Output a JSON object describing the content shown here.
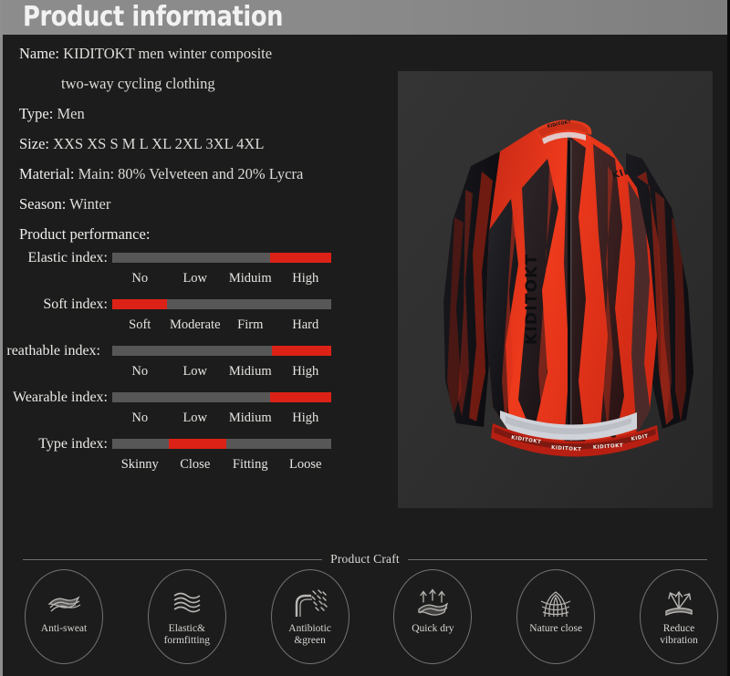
{
  "header": {
    "title": "Product information"
  },
  "colors": {
    "page_bg": "#1c1c1c",
    "header_gray": "#8c8c8c",
    "bar_track": "#575757",
    "bar_fill_red": "#dc2216",
    "text": "#e8e6e2",
    "panel_bg": "#2e2e2e",
    "badge_outline": "#737373",
    "jersey_red": "#e8361c",
    "jersey_black": "#16161a"
  },
  "info": {
    "lines": [
      {
        "key": "Name:",
        "value": "KIDITOKT men winter composite"
      },
      {
        "key": "",
        "value": "two-way cycling clothing",
        "indented": true
      },
      {
        "key": "Type:",
        "value": "Men"
      },
      {
        "key": "Size:",
        "value": "XXS XS S M L XL 2XL 3XL 4XL"
      },
      {
        "key": "Material:",
        "value": "Main: 80% Velveteen and 20% Lycra"
      },
      {
        "key": "Season:",
        "value": "Winter"
      },
      {
        "key": "Product performance:",
        "value": ""
      }
    ]
  },
  "performance": {
    "rows": [
      {
        "label": "Elastic index:",
        "fill_start_pct": 72,
        "fill_end_pct": 100,
        "scale": [
          "No",
          "Low",
          "Miduim",
          "High"
        ],
        "selected": "High"
      },
      {
        "label": "Soft index:",
        "fill_start_pct": 0,
        "fill_end_pct": 25,
        "scale": [
          "Soft",
          "Moderate",
          "Firm",
          "Hard"
        ],
        "selected": "Soft"
      },
      {
        "label": "reathable index:",
        "fill_start_pct": 73,
        "fill_end_pct": 100,
        "scale": [
          "No",
          "Low",
          "Midium",
          "High"
        ],
        "selected": "High",
        "clipped": true
      },
      {
        "label": "Wearable index:",
        "fill_start_pct": 72,
        "fill_end_pct": 100,
        "scale": [
          "No",
          "Low",
          "Midium",
          "High"
        ],
        "selected": "High"
      },
      {
        "label": "Type index:",
        "fill_start_pct": 26,
        "fill_end_pct": 52,
        "scale": [
          "Skinny",
          "Close",
          "Fitting",
          "Loose"
        ],
        "selected": "Close"
      }
    ]
  },
  "product_image": {
    "brand_chest": "KIDITOKT",
    "brand_shoulder": "KIDIT",
    "brand_hem": "KIDITOKT"
  },
  "craft": {
    "title": "Product Craft",
    "badges": [
      {
        "label": "Anti-sweat",
        "icon": "fabric-layers-icon"
      },
      {
        "label": "Elastic&\nformfitting",
        "icon": "wavy-lines-icon"
      },
      {
        "label": "Antibiotic\n&green",
        "icon": "particle-deflect-icon"
      },
      {
        "label": "Quick dry",
        "icon": "evaporation-arrows-icon"
      },
      {
        "label": "Nature close",
        "icon": "woven-mesh-icon"
      },
      {
        "label": "Reduce\nvibration",
        "icon": "vibration-deflect-icon"
      }
    ]
  }
}
